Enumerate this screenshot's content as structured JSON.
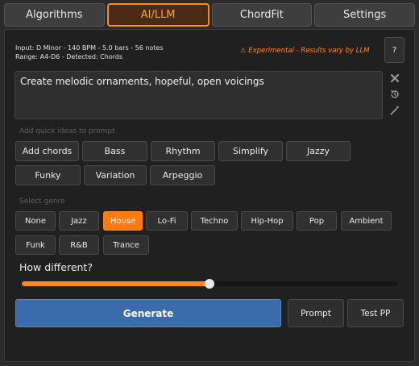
{
  "tabs": [
    {
      "label": "Algorithms"
    },
    {
      "label": "AI/LLM"
    },
    {
      "label": "ChordFit"
    },
    {
      "label": "Settings"
    }
  ],
  "info": {
    "line1": "Input: D Minor - 140 BPM - 5.0 bars - 56 notes",
    "line2": "Range: A4-D6 - Detected: Chords"
  },
  "warning": {
    "icon": "warning-icon",
    "text": "Experimental - Results vary by LLM"
  },
  "help": {
    "label": "?"
  },
  "prompt": {
    "text": "Create melodic ornaments, hopeful, open voicings"
  },
  "side_icons": [
    "close-icon",
    "history-icon",
    "magic-wand-icon"
  ],
  "quick_ideas": {
    "label": "Add quick ideas to prompt",
    "items": [
      "Add chords",
      "Bass",
      "Rhythm",
      "Simplify",
      "Jazzy",
      "Funky",
      "Variation",
      "Arpeggio"
    ]
  },
  "genre": {
    "label": "Select genre",
    "items": [
      "None",
      "Jazz",
      "House",
      "Lo-Fi",
      "Techno",
      "Hip-Hop",
      "Pop",
      "Ambient",
      "Funk",
      "R&B",
      "Trance"
    ],
    "selected": "House"
  },
  "how_different": {
    "label": "How different?",
    "value": 0.5
  },
  "actions": {
    "generate": "Generate",
    "prompt": "Prompt",
    "test": "Test PP"
  },
  "colors": {
    "accent": "#ff8a1c",
    "primary": "#3a6bab",
    "background": "#202020"
  }
}
